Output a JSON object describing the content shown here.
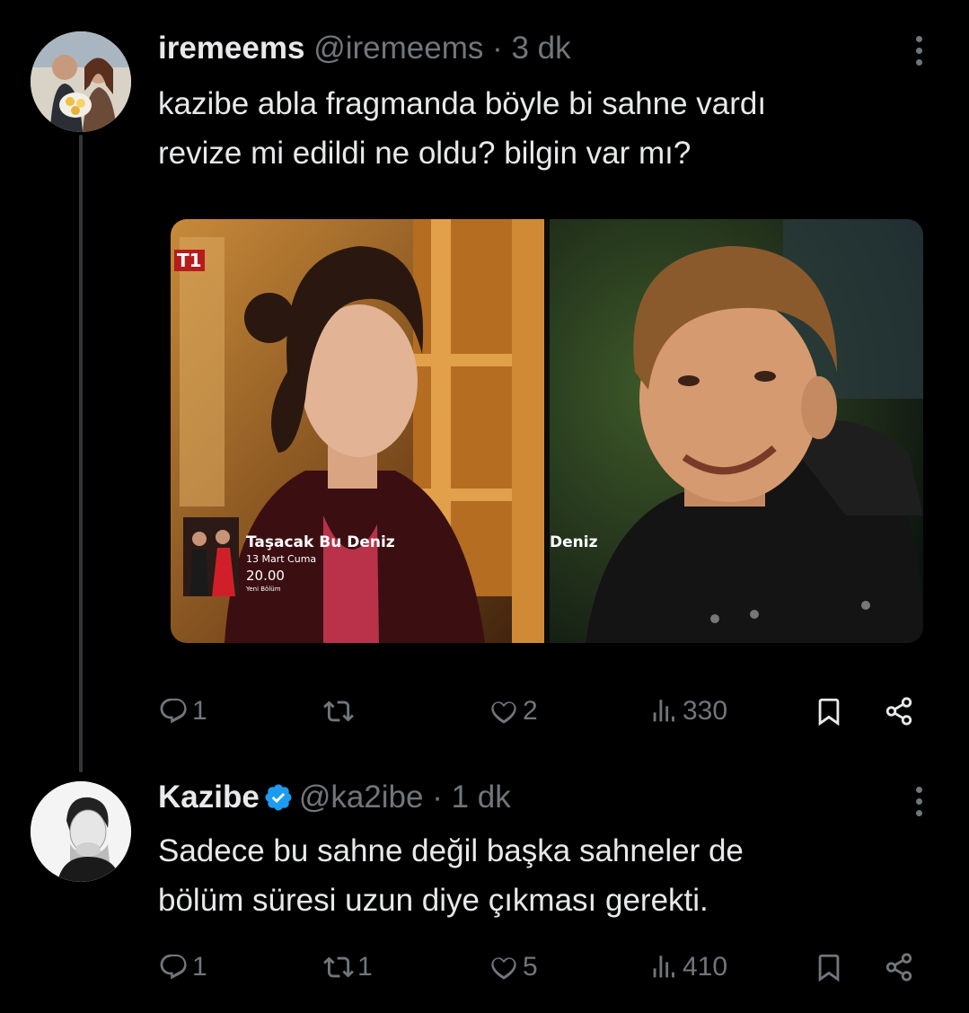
{
  "tweet1": {
    "display_name": "iremeems",
    "handle": "@iremeems",
    "separator": "·",
    "time": "3 dk",
    "text_line1": "kazibe abla fragmanda böyle bi sahne vardı",
    "text_line2": "revize mi edildi ne oldu? bilgin var mı?",
    "media": {
      "channel_logo": "T1",
      "show_title": "Taşacak Bu Deniz",
      "air_date": "13 Mart Cuma",
      "air_time": "20.00",
      "episode_note": "Yeni Bölüm",
      "right_title_fragment": "Deniz"
    },
    "actions": {
      "replies": "1",
      "reposts": "",
      "likes": "2",
      "views": "330"
    }
  },
  "tweet2": {
    "display_name": "Kazibe",
    "handle": "@ka2ibe",
    "separator": "·",
    "time": "1 dk",
    "text_line1": "Sadece bu sahne değil başka sahneler de",
    "text_line2": "bölüm süresi uzun diye çıkması gerekti.",
    "actions": {
      "replies": "1",
      "reposts": "1",
      "likes": "5",
      "views": "410"
    }
  },
  "colors": {
    "background": "#000000",
    "text": "#e7e9ea",
    "muted": "#71767b",
    "verified": "#1d9bf0"
  },
  "icons": [
    "reply-icon",
    "repost-icon",
    "like-icon",
    "views-icon",
    "bookmark-icon",
    "share-icon",
    "more-icon",
    "verified-badge-icon"
  ]
}
